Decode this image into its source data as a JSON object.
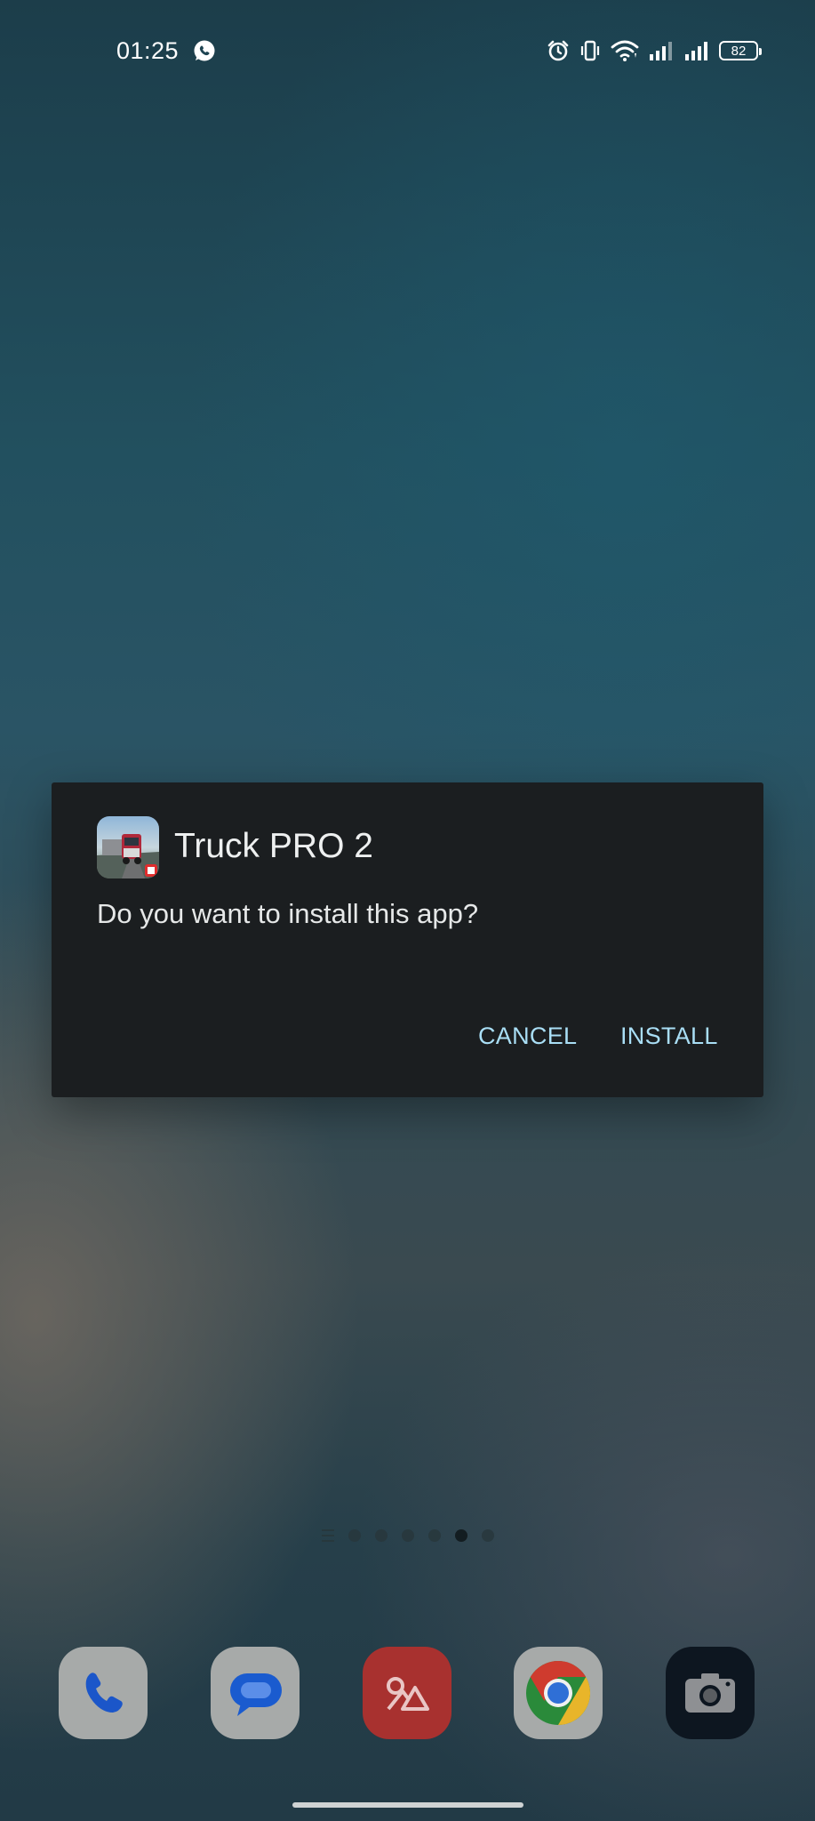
{
  "status_bar": {
    "time": "01:25",
    "battery_level": "82",
    "icons": [
      "whatsapp-icon",
      "alarm-icon",
      "vibrate-icon",
      "wifi-icon",
      "signal-icon",
      "signal-icon",
      "battery-icon"
    ]
  },
  "dialog": {
    "app_name": "Truck PRO 2",
    "message": "Do you want to install this app?",
    "cancel_label": "CANCEL",
    "install_label": "INSTALL",
    "button_color": "#a9def5",
    "background_color": "#1b1e20"
  },
  "home": {
    "page_count": 6,
    "active_page": 5,
    "dock": [
      "phone-icon",
      "messages-icon",
      "gallery-icon",
      "chrome-icon",
      "camera-icon"
    ]
  }
}
